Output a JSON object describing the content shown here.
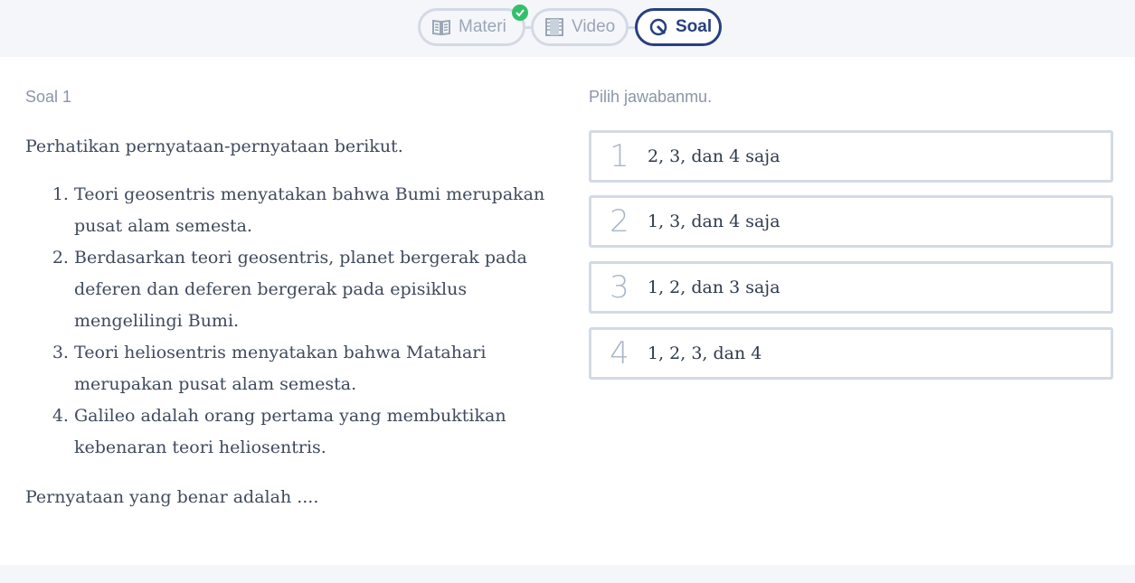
{
  "tabs": [
    {
      "label": "Materi",
      "icon": "book-icon",
      "completed": true
    },
    {
      "label": "Video",
      "icon": "film-icon"
    },
    {
      "label": "Soal",
      "icon": "quiz-icon",
      "active": true
    }
  ],
  "question": {
    "number_label": "Soal 1",
    "intro": "Perhatikan pernyataan-pernyataan berikut.",
    "statements": [
      "Teori geosentris menyatakan bahwa Bumi merupakan pusat alam semesta.",
      "Berdasarkan teori geosentris, planet bergerak pada deferen dan deferen bergerak pada episiklus mengelilingi Bumi.",
      "Teori heliosentris menyatakan bahwa Matahari merupakan pusat alam semesta.",
      "Galileo adalah orang pertama yang membuktikan kebenaran teori heliosentris."
    ],
    "prompt": "Pernyataan yang benar adalah ...."
  },
  "answers": {
    "heading": "Pilih jawabanmu.",
    "options": [
      {
        "num": "1",
        "text": "2,  3, dan 4 saja"
      },
      {
        "num": "2",
        "text": "1,  3, dan 4 saja"
      },
      {
        "num": "3",
        "text": "1,  2, dan 3 saja"
      },
      {
        "num": "4",
        "text": "1,  2,  3, dan 4"
      }
    ]
  },
  "colors": {
    "accent": "#27407f",
    "border": "#d3dae4",
    "success": "#34c06a",
    "muted": "#8a96a6"
  }
}
